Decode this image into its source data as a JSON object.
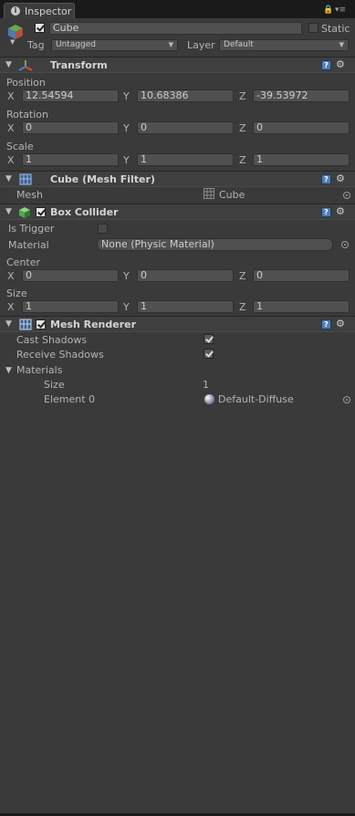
{
  "tab": {
    "title": "Inspector"
  },
  "object": {
    "name": "Cube",
    "static_label": "Static",
    "tag_label": "Tag",
    "tag_value": "Untagged",
    "layer_label": "Layer",
    "layer_value": "Default"
  },
  "transform": {
    "title": "Transform",
    "position_label": "Position",
    "rotation_label": "Rotation",
    "scale_label": "Scale",
    "axis_x": "X",
    "axis_y": "Y",
    "axis_z": "Z",
    "position": {
      "x": "12.54594",
      "y": "10.68386",
      "z": "-39.53972"
    },
    "rotation": {
      "x": "0",
      "y": "0",
      "z": "0"
    },
    "scale": {
      "x": "1",
      "y": "1",
      "z": "1"
    }
  },
  "mesh_filter": {
    "title": "Cube (Mesh Filter)",
    "mesh_label": "Mesh",
    "mesh_value": "Cube"
  },
  "box_collider": {
    "title": "Box Collider",
    "is_trigger_label": "Is Trigger",
    "material_label": "Material",
    "material_value": "None (Physic Material)",
    "center_label": "Center",
    "size_label": "Size",
    "center": {
      "x": "0",
      "y": "0",
      "z": "0"
    },
    "size": {
      "x": "1",
      "y": "1",
      "z": "1"
    }
  },
  "mesh_renderer": {
    "title": "Mesh Renderer",
    "cast_shadows_label": "Cast Shadows",
    "receive_shadows_label": "Receive Shadows",
    "materials_label": "Materials",
    "size_label": "Size",
    "size_value": "1",
    "element0_label": "Element 0",
    "element0_value": "Default-Diffuse"
  }
}
